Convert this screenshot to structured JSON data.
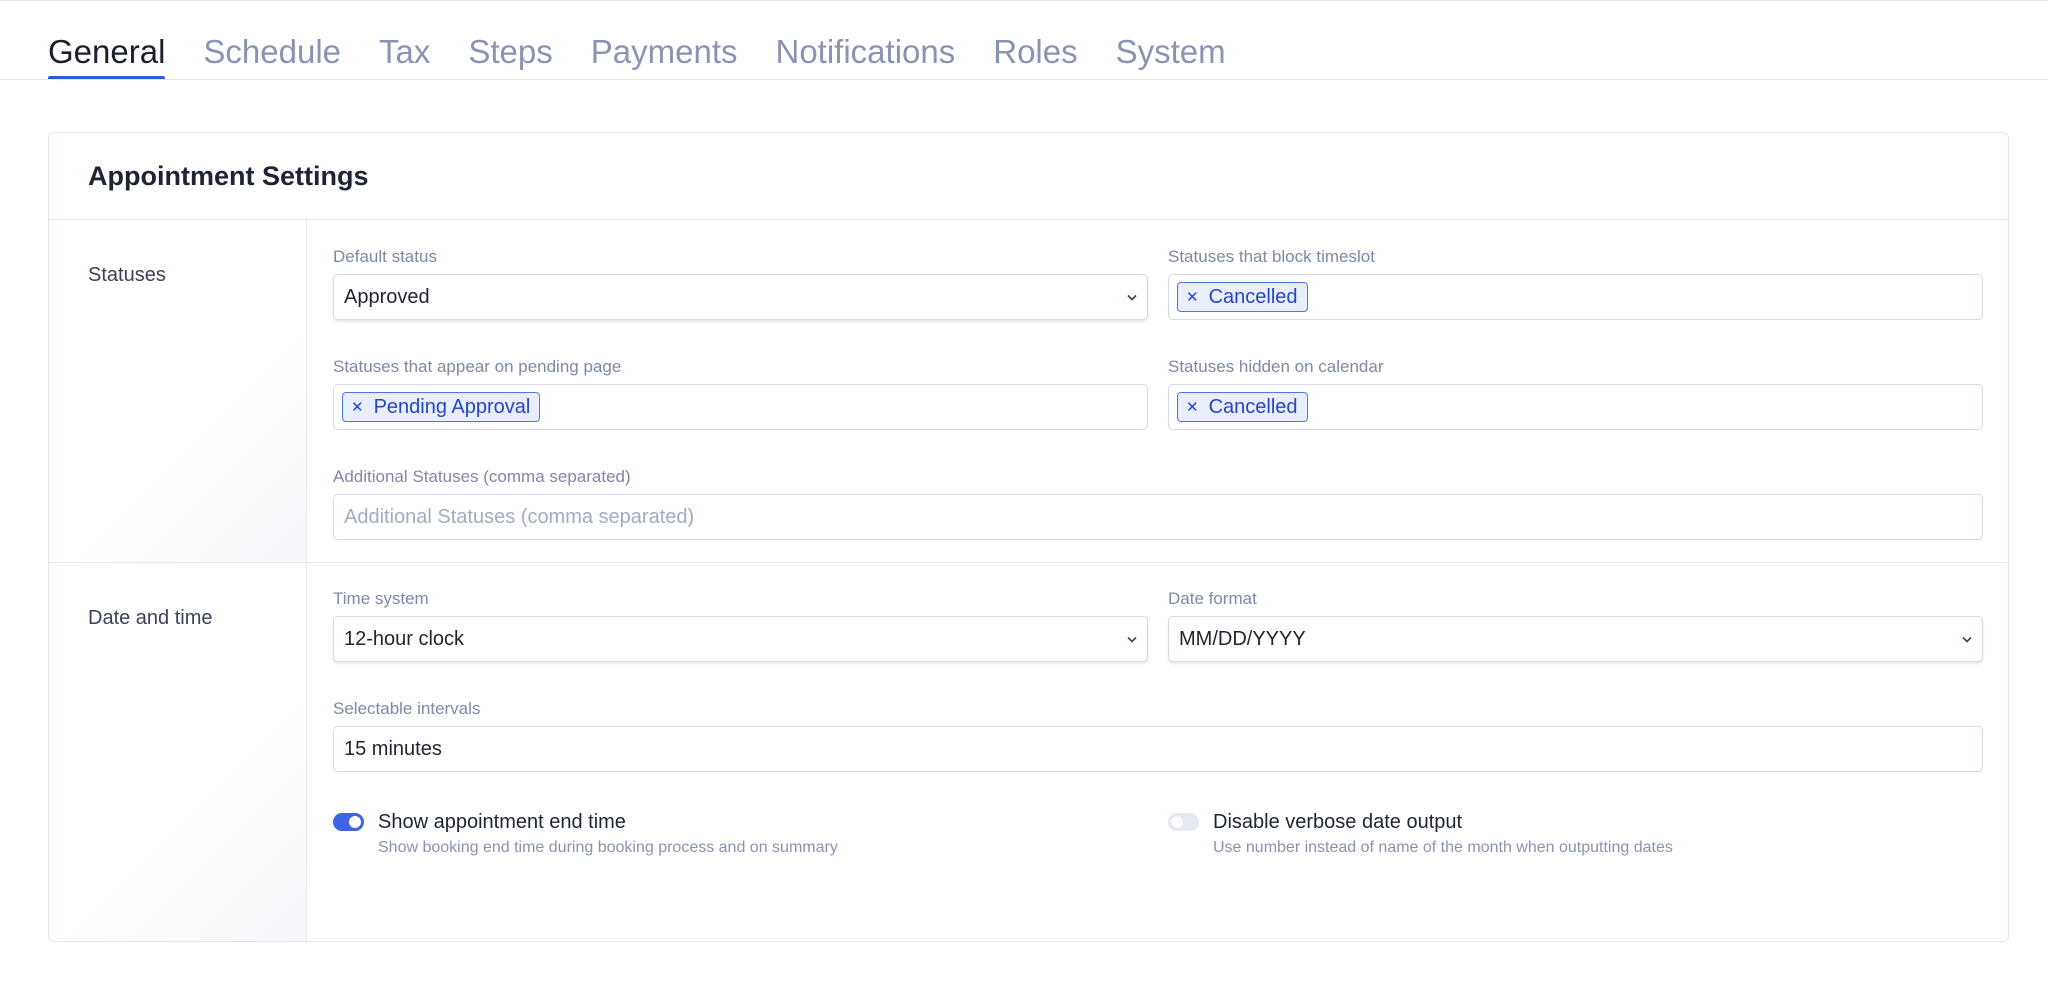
{
  "tabs": [
    {
      "label": "General",
      "active": true
    },
    {
      "label": "Schedule",
      "active": false
    },
    {
      "label": "Tax",
      "active": false
    },
    {
      "label": "Steps",
      "active": false
    },
    {
      "label": "Payments",
      "active": false
    },
    {
      "label": "Notifications",
      "active": false
    },
    {
      "label": "Roles",
      "active": false
    },
    {
      "label": "System",
      "active": false
    }
  ],
  "card": {
    "title": "Appointment Settings"
  },
  "statuses": {
    "label": "Statuses",
    "default_status": {
      "label": "Default status",
      "value": "Approved"
    },
    "block_timeslot": {
      "label": "Statuses that block timeslot",
      "tags": [
        "Cancelled"
      ]
    },
    "pending_page": {
      "label": "Statuses that appear on pending page",
      "tags": [
        "Pending Approval"
      ]
    },
    "hidden_calendar": {
      "label": "Statuses hidden on calendar",
      "tags": [
        "Cancelled"
      ]
    },
    "additional": {
      "label": "Additional Statuses (comma separated)",
      "placeholder": "Additional Statuses (comma separated)"
    }
  },
  "datetime": {
    "label": "Date and time",
    "time_system": {
      "label": "Time system",
      "value": "12-hour clock"
    },
    "date_format": {
      "label": "Date format",
      "value": "MM/DD/YYYY"
    },
    "intervals": {
      "label": "Selectable intervals",
      "value": "15 minutes"
    },
    "show_end_time": {
      "title": "Show appointment end time",
      "description": "Show booking end time during booking process and on summary",
      "enabled": true
    },
    "verbose_date": {
      "title": "Disable verbose date output",
      "description": "Use number instead of name of the month when outputting dates",
      "enabled": false
    }
  },
  "icons": {
    "tag_remove": "close-icon",
    "select_arrow": "chevron-down-icon"
  },
  "colors": {
    "accent": "#2d5be3",
    "tag_bg": "#e9eefd",
    "tag_border": "#5173e6",
    "muted_text": "#8a93b4"
  }
}
